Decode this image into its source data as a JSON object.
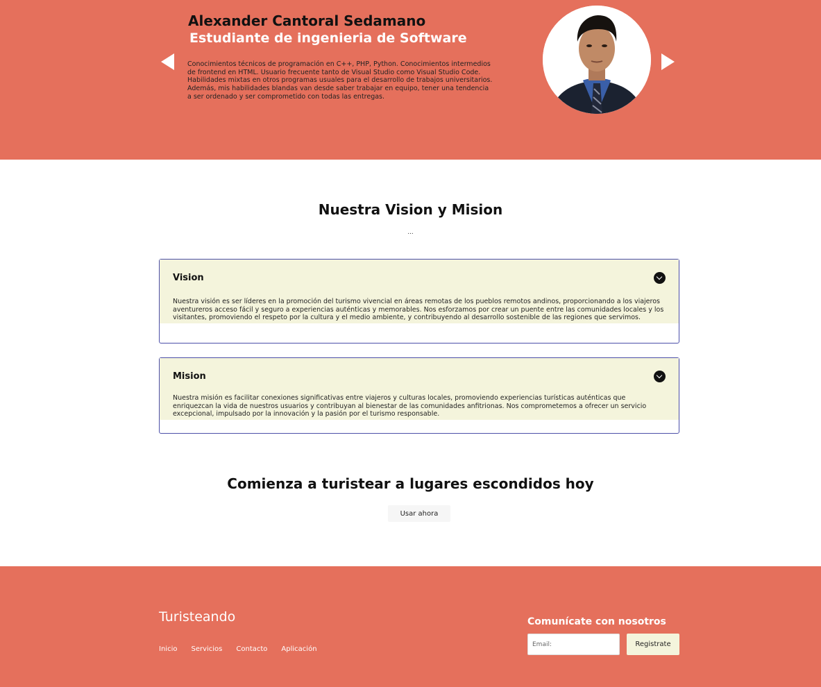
{
  "hero": {
    "name": "Alexander Cantoral Sedamano",
    "role": "Estudiante de ingenieria de Software",
    "bio": "Conocimientos técnicos de programación en C++, PHP, Python. Conocimientos intermedios de frontend en HTML. Usuario frecuente tanto de Visual Studio como Visual Studio Code. Habilidades mixtas en otros programas usuales para el desarrollo de trabajos universitarios. Además, mis habilidades blandas van desde saber trabajar en equipo, tener una tendencia a ser ordenado y ser comprometido con todas las entregas.",
    "prev_icon": "chevron-left-icon",
    "next_icon": "chevron-right-icon"
  },
  "vision_mision": {
    "title": "Nuestra Vision y Mision",
    "dots": "...",
    "items": [
      {
        "label": "Vision",
        "text": "Nuestra visión es ser líderes en la promoción del turismo vivencial en áreas remotas de los pueblos remotos andinos, proporcionando a los viajeros aventureros acceso fácil y seguro a experiencias auténticas y memorables. Nos esforzamos por crear un puente entre las comunidades locales y los visitantes, promoviendo el respeto por la cultura y el medio ambiente, y contribuyendo al desarrollo sostenible de las regiones que servimos."
      },
      {
        "label": "Mision",
        "text": "Nuestra misión es facilitar conexiones significativas entre viajeros y culturas locales, promoviendo experiencias turísticas auténticas que enriquezcan la vida de nuestros usuarios y contribuyan al bienestar de las comunidades anfitrionas. Nos comprometemos a ofrecer un servicio excepcional, impulsado por la innovación y la pasión por el turismo responsable."
      }
    ]
  },
  "cta": {
    "title": "Comienza a turistear a lugares escondidos hoy",
    "button": "Usar ahora"
  },
  "footer": {
    "brand": "Turisteando",
    "nav": [
      "Inicio",
      "Servicios",
      "Contacto",
      "Aplicación"
    ],
    "contact_title": "Comunícate con nosotros",
    "email_placeholder": "Email:",
    "register_button": "Registrate"
  },
  "colors": {
    "accent": "#e5705c",
    "panel": "#f4f4dc",
    "border": "#4b4ea8"
  }
}
